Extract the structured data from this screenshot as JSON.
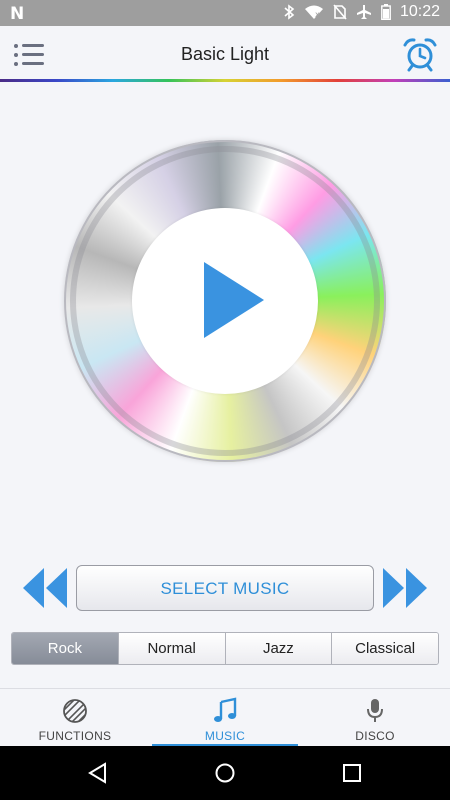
{
  "status_bar": {
    "time": "10:22",
    "left_icon": "notification-n-icon",
    "icons": [
      "bluetooth-icon",
      "wifi-icon",
      "no-sim-icon",
      "airplane-icon",
      "battery-icon"
    ]
  },
  "header": {
    "title": "Basic Light",
    "menu_icon": "menu-list-icon",
    "alarm_icon": "alarm-clock-icon"
  },
  "player": {
    "play_icon": "play-icon",
    "rewind_icon": "rewind-icon",
    "fast_forward_icon": "fast-forward-icon",
    "select_music_label": "SELECT MUSIC"
  },
  "genres": {
    "selected": "Rock",
    "items": [
      {
        "label": "Rock"
      },
      {
        "label": "Normal"
      },
      {
        "label": "Jazz"
      },
      {
        "label": "Classical"
      }
    ]
  },
  "bottom_nav": {
    "active": "MUSIC",
    "items": [
      {
        "label": "FUNCTIONS",
        "icon": "striped-circle-icon"
      },
      {
        "label": "MUSIC",
        "icon": "music-note-icon"
      },
      {
        "label": "DISCO",
        "icon": "microphone-icon"
      }
    ]
  },
  "android_nav": [
    "back-icon",
    "home-icon",
    "recents-icon"
  ],
  "colors": {
    "accent": "#2f8fd8",
    "background": "#f4f5f9",
    "genre_active": "#8f949f"
  }
}
